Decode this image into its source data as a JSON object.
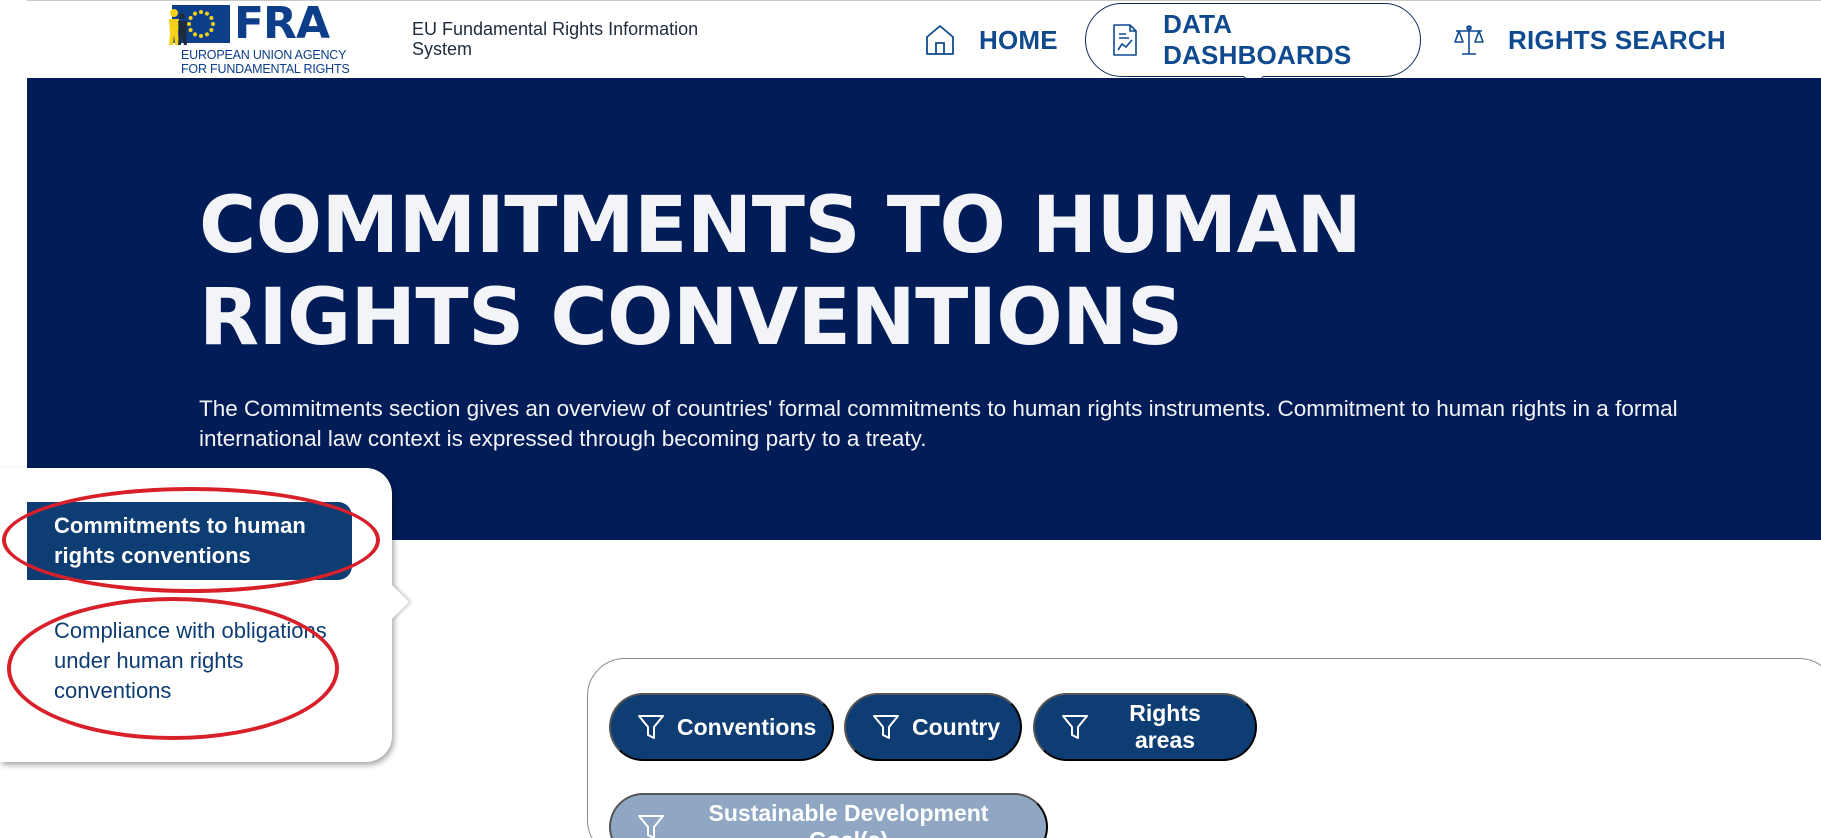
{
  "header": {
    "logo_text": "FRA",
    "logo_subtitle_line1": "EUROPEAN UNION AGENCY",
    "logo_subtitle_line2": "FOR FUNDAMENTAL RIGHTS",
    "system_title": "EU Fundamental Rights Information System"
  },
  "nav": {
    "home": "HOME",
    "data_dashboards": "DATA DASHBOARDS",
    "rights_search": "RIGHTS SEARCH"
  },
  "hero": {
    "title": "COMMITMENTS TO HUMAN RIGHTS CONVENTIONS",
    "description": "The Commitments section gives an overview of countries' formal commitments to human rights instruments. Commitment to human rights in a formal international law context is expressed through becoming party to a treaty."
  },
  "sidebar": {
    "items": [
      {
        "label": "Commitments to human rights conventions",
        "active": true
      },
      {
        "label": "Compliance with obligations under human rights conventions",
        "active": false
      }
    ]
  },
  "filters": {
    "conventions": "Conventions",
    "country": "Country",
    "rights_areas": "Rights areas",
    "sdg": "Sustainable Development Goal(s)"
  },
  "colors": {
    "navy": "#011c56",
    "button_blue": "#0e3d73",
    "link_blue": "#0f4a8f",
    "disabled_button": "#8fa7c2",
    "annotation_red": "#d8202a"
  }
}
